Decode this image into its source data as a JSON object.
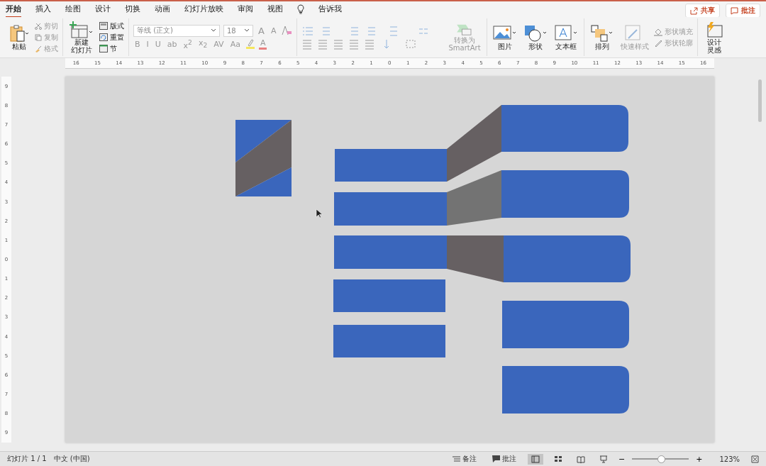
{
  "tabs": [
    {
      "label": "开始",
      "selected": true
    },
    {
      "label": "插入",
      "selected": false
    },
    {
      "label": "绘图",
      "selected": false
    },
    {
      "label": "设计",
      "selected": false
    },
    {
      "label": "切换",
      "selected": false
    },
    {
      "label": "动画",
      "selected": false
    },
    {
      "label": "幻灯片放映",
      "selected": false
    },
    {
      "label": "审阅",
      "selected": false
    },
    {
      "label": "视图",
      "selected": false
    }
  ],
  "tell_me": "告诉我",
  "header_buttons": [
    {
      "kind": "share",
      "label": "共享"
    },
    {
      "kind": "comment",
      "label": "批注"
    }
  ],
  "clipboard": {
    "paste": "粘贴",
    "items": [
      {
        "kind": "cut",
        "label": "剪切",
        "disabled": true
      },
      {
        "kind": "copy",
        "label": "复制",
        "disabled": true
      },
      {
        "kind": "format",
        "label": "格式",
        "disabled": true
      }
    ]
  },
  "slides": {
    "new_slide": [
      "新建",
      "幻灯片"
    ],
    "items": [
      {
        "kind": "layout",
        "label": "版式"
      },
      {
        "kind": "reset",
        "label": "重置"
      },
      {
        "kind": "section",
        "label": "节"
      }
    ]
  },
  "font": {
    "name": "等线 (正文)",
    "size": "18",
    "grow": "A",
    "shrink": "A",
    "buttons": [
      "B",
      "I",
      "U",
      "ab",
      "x$^{2}$",
      "x$_{2}$",
      "AV",
      "Aa"
    ],
    "color_letter": "A"
  },
  "smartart": [
    "转换为",
    "SmartArt"
  ],
  "insert": [
    {
      "kind": "picture",
      "label": "图片"
    },
    {
      "kind": "shape",
      "label": "形状"
    },
    {
      "kind": "textbox",
      "label": "文本框"
    }
  ],
  "arrange": {
    "label": "排列",
    "quick_styles": "快速样式",
    "fill": "形状填充",
    "outline": "形状轮廓"
  },
  "designer": [
    "设计",
    "灵感"
  ],
  "ruler_h": [
    "16",
    "15",
    "14",
    "13",
    "12",
    "11",
    "10",
    "9",
    "8",
    "7",
    "6",
    "5",
    "4",
    "3",
    "2",
    "1",
    "0",
    "1",
    "2",
    "3",
    "4",
    "5",
    "6",
    "7",
    "8",
    "9",
    "10",
    "11",
    "12",
    "13",
    "14",
    "15",
    "16"
  ],
  "ruler_v": [
    "9",
    "8",
    "7",
    "6",
    "5",
    "4",
    "3",
    "2",
    "1",
    "0",
    "1",
    "2",
    "3",
    "4",
    "5",
    "6",
    "7",
    "8",
    "9"
  ],
  "status_bar": {
    "slide": "幻灯片 1 / 1",
    "language": "中文 (中国)",
    "notes": "备注",
    "comments": "批注",
    "views": [
      {
        "kind": "normal",
        "selected": true
      },
      {
        "kind": "sorter",
        "selected": false
      },
      {
        "kind": "reading",
        "selected": false
      },
      {
        "kind": "show",
        "selected": false
      }
    ],
    "zoom": {
      "minus": "−",
      "plus": "+",
      "level": 0.51,
      "percent": "123%"
    }
  }
}
